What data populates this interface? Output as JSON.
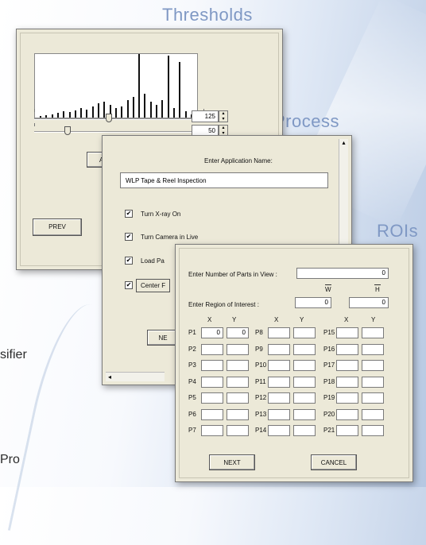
{
  "headings": {
    "thresholds": "Thresholds",
    "process": "Process",
    "rois": "ROIs"
  },
  "side_text": {
    "classifier": "sifier",
    "pro": "Pro"
  },
  "thresholds_window": {
    "slider1_value": "125",
    "slider2_value": "50",
    "auto_button": "AUT",
    "prev_button": "PREV",
    "histogram_peaks": [
      2,
      3,
      4,
      6,
      8,
      7,
      9,
      12,
      10,
      14,
      18,
      20,
      16,
      12,
      14,
      22,
      26,
      80,
      30,
      20,
      16,
      22,
      78,
      12,
      70,
      8,
      4
    ]
  },
  "process_window": {
    "prompt": "Enter Application Name:",
    "app_name": "WLP Tape & Reel Inspection",
    "checkboxes": [
      {
        "label": "Turn X-ray On",
        "checked": true
      },
      {
        "label": "Turn Camera in Live",
        "checked": true
      },
      {
        "label": "Load Pa",
        "checked": true
      },
      {
        "label": "Center F",
        "checked": true
      }
    ],
    "next_button": "NE",
    "scroll_left": "◂",
    "scroll_up": "▴"
  },
  "roi_window": {
    "parts_label": "Enter Number of Parts in View :",
    "parts_value": "0",
    "roi_label": "Enter Region of Interest :",
    "w_header": "W",
    "h_header": "H",
    "w_value": "0",
    "h_value": "0",
    "col_x": "X",
    "col_y": "Y",
    "p1_x": "0",
    "p1_y": "0",
    "rows": [
      [
        "P1",
        "P8",
        "P15"
      ],
      [
        "P2",
        "P9",
        "P16"
      ],
      [
        "P3",
        "P10",
        "P17"
      ],
      [
        "P4",
        "P11",
        "P18"
      ],
      [
        "P5",
        "P12",
        "P19"
      ],
      [
        "P6",
        "P13",
        "P20"
      ],
      [
        "P7",
        "P14",
        "P21"
      ]
    ],
    "next_button": "NEXT",
    "cancel_button": "CANCEL"
  }
}
